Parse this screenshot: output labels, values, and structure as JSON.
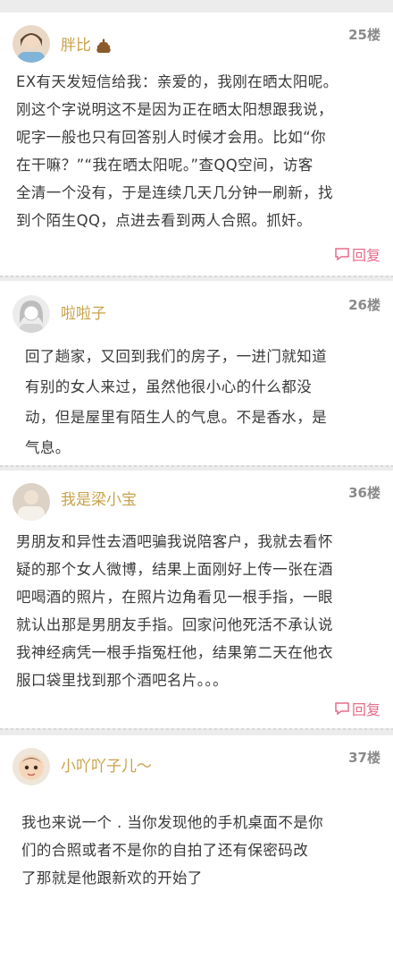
{
  "posts": [
    {
      "username": "胖比",
      "floor": "25楼",
      "content": [
        "EX有天发短信给我：亲爱的，我刚在晒太阳呢。",
        "刚这个字说明这不是因为正在晒太阳想跟我说，",
        "呢字一般也只有回答别人时候才会用。比如“你",
        "在干嘛？”“我在晒太阳呢。”查QQ空间，访客",
        "全清一个没有，于是连续几天几分钟一刷新，找",
        "到个陌生QQ，点进去看到两人合照。抓奸。"
      ],
      "reply_label": "回复"
    },
    {
      "username": "啦啦子",
      "floor": "26楼",
      "content": [
        "回了趟家，又回到我们的房子，一进门就知道",
        "有别的女人来过，虽然他很小心的什么都没",
        "动，但是屋里有陌生人的气息。不是香水，是",
        "气息。"
      ]
    },
    {
      "username": "我是梁小宝",
      "floor": "36楼",
      "content": [
        "男朋友和异性去酒吧骗我说陪客户，我就去看怀",
        "疑的那个女人微博，结果上面刚好上传一张在酒",
        "吧喝酒的照片，在照片边角看见一根手指，一眼",
        "就认出那是男朋友手指。回家问他死活不承认说",
        "我神经病凭一根手指冤枉他，结果第二天在他衣",
        "服口袋里找到那个酒吧名片。。。"
      ],
      "reply_label": "回复"
    },
    {
      "username": "小吖吖子儿～",
      "floor": "37楼",
      "content": [
        "我也来说一个 . 当你发现他的手机桌面不是你",
        "们的合照或者不是你的自拍了还有保密码改",
        "了那就是他跟新欢的开始了"
      ]
    }
  ],
  "colors": {
    "username": "#c9a24a",
    "reply": "#e86b8a",
    "floor": "#8a8a8a"
  },
  "icons": {
    "reply": "speech-bubble-icon",
    "emoji": "poop-emoji-icon"
  }
}
